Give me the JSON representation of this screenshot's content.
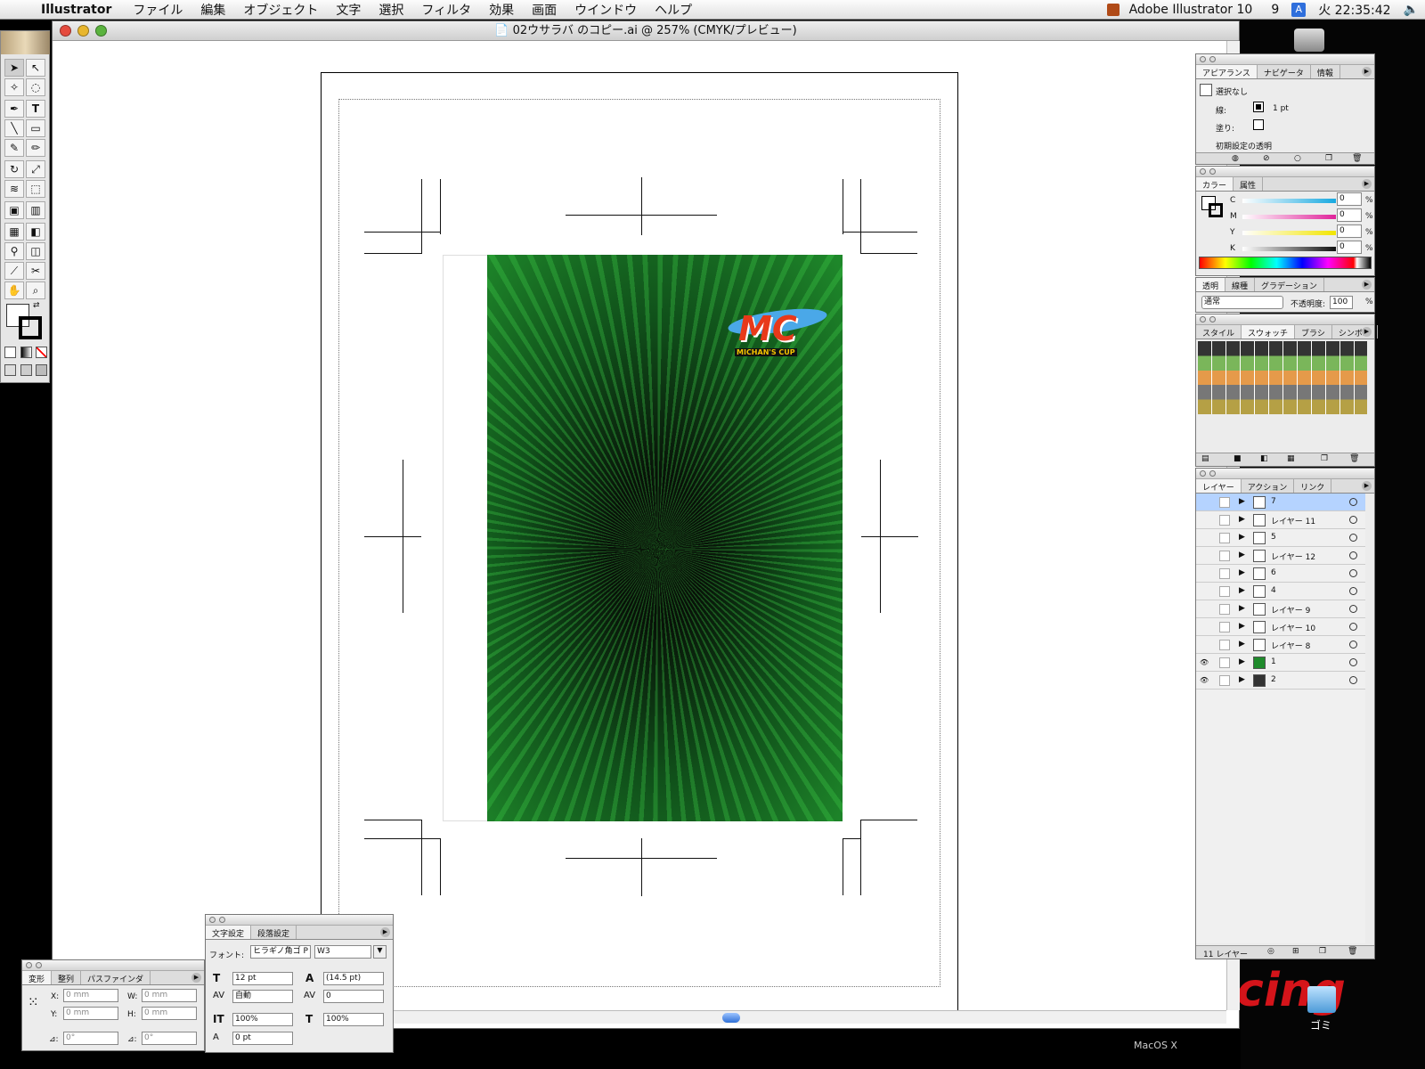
{
  "menubar": {
    "app": "Illustrator",
    "items": [
      "ファイル",
      "編集",
      "オブジェクト",
      "文字",
      "選択",
      "フィルタ",
      "効果",
      "画面",
      "ウインドウ",
      "ヘルプ"
    ],
    "right_app": "Adobe Illustrator 10",
    "script_glyph": "9",
    "ime": "A",
    "clock": "火 22:35:42"
  },
  "window": {
    "title": "02ウサラバ のコピー.ai @ 257% (CMYK/プレビュー)"
  },
  "desktop": {
    "trash_label": "ゴミ",
    "os_label": "MacOS X",
    "bg_text": "cing"
  },
  "appearance": {
    "tabs": [
      "アピアランス",
      "ナビゲータ",
      "情報"
    ],
    "selection": "選択なし",
    "stroke_label": "線:",
    "stroke_value": "1 pt",
    "fill_label": "塗り:",
    "default_transparency": "初期設定の透明"
  },
  "color": {
    "tabs": [
      "カラー",
      "属性"
    ],
    "channels": [
      {
        "name": "C",
        "value": "0",
        "unit": "%",
        "color": "#18a9e0"
      },
      {
        "name": "M",
        "value": "0",
        "unit": "%",
        "color": "#e0239a"
      },
      {
        "name": "Y",
        "value": "0",
        "unit": "%",
        "color": "#f2e500"
      },
      {
        "name": "K",
        "value": "0",
        "unit": "%",
        "color": "#333333"
      }
    ]
  },
  "transparency": {
    "tabs": [
      "透明",
      "線種",
      "グラデーション"
    ],
    "mode": "通常",
    "opacity_label": "不透明度:",
    "opacity_value": "100",
    "unit": "%"
  },
  "swatches": {
    "tabs": [
      "スタイル",
      "スウォッチ",
      "ブラシ",
      "シンボル"
    ]
  },
  "layers": {
    "tabs": [
      "レイヤー",
      "アクション",
      "リンク"
    ],
    "count_label": "11 レイヤー",
    "rows": [
      {
        "name": "7",
        "visible": false,
        "selected": true
      },
      {
        "name": "レイヤー 11",
        "visible": false,
        "selected": false
      },
      {
        "name": "5",
        "visible": false,
        "selected": false
      },
      {
        "name": "レイヤー 12",
        "visible": false,
        "selected": false
      },
      {
        "name": "6",
        "visible": false,
        "selected": false
      },
      {
        "name": "4",
        "visible": false,
        "selected": false
      },
      {
        "name": "レイヤー 9",
        "visible": false,
        "selected": false
      },
      {
        "name": "レイヤー 10",
        "visible": false,
        "selected": false
      },
      {
        "name": "レイヤー 8",
        "visible": false,
        "selected": false
      },
      {
        "name": "1",
        "visible": true,
        "selected": false
      },
      {
        "name": "2",
        "visible": true,
        "selected": false
      }
    ]
  },
  "transform": {
    "tabs": [
      "変形",
      "整列",
      "パスファインダ"
    ],
    "x_label": "X:",
    "x_value": "0 mm",
    "y_label": "Y:",
    "y_value": "0 mm",
    "w_label": "W:",
    "w_value": "0 mm",
    "h_label": "H:",
    "h_value": "0 mm",
    "rot_label": "⊿:",
    "rot_value": "0°",
    "shear_label": "⊿:",
    "shear_value": "0°"
  },
  "character": {
    "tabs": [
      "文字設定",
      "段落設定"
    ],
    "font_label": "フォント:",
    "font_name": "ヒラギノ角ゴ P",
    "font_style": "W3",
    "size": "12 pt",
    "leading": "(14.5 pt)",
    "kerning": "自動",
    "tracking": "0",
    "vscale": "100%",
    "hscale": "100%",
    "baseline": "0 pt"
  },
  "artwork": {
    "logo_text": "MC",
    "logo_sub": "MICHAN'S CUP"
  },
  "colors": {
    "art_green": "#1f8a2b",
    "selection_blue": "#b5d3ff",
    "accent_blue": "#2f6fdc"
  }
}
